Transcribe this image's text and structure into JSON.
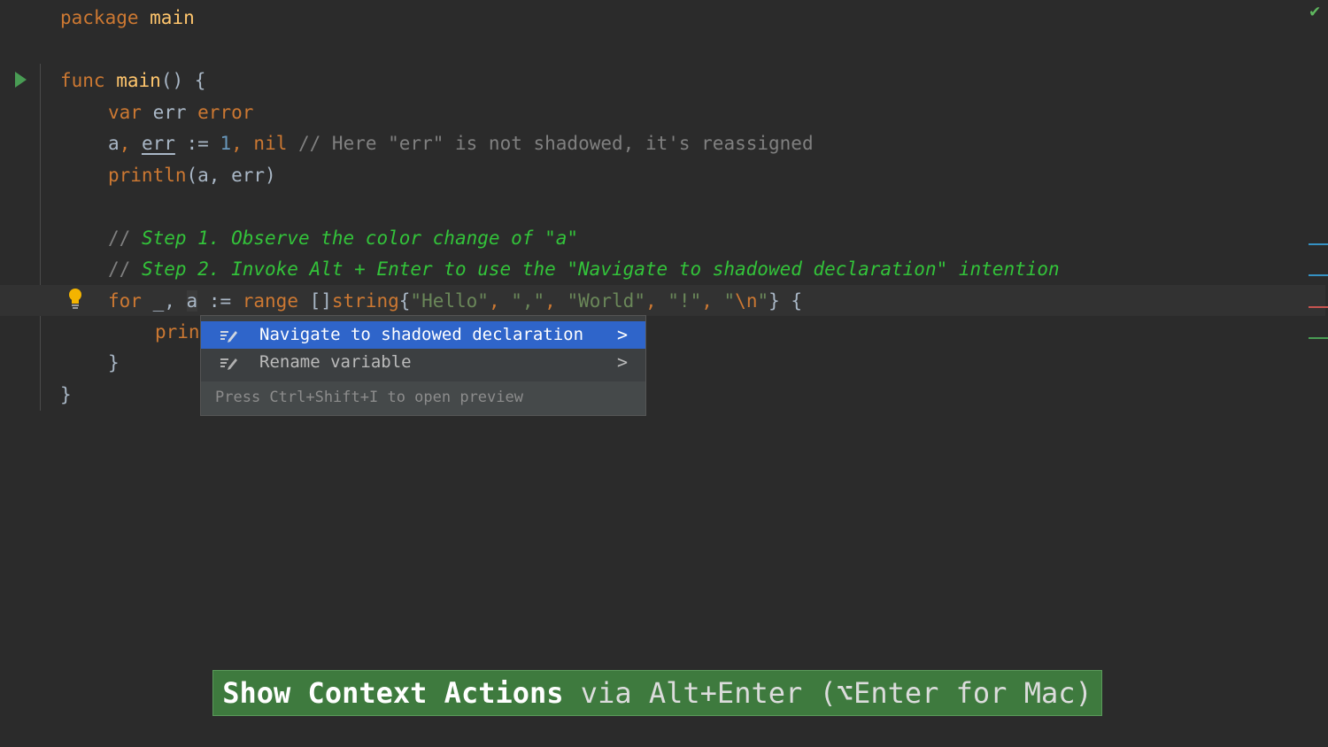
{
  "editor": {
    "line1": [
      "package",
      " main"
    ],
    "line2": [
      "func",
      " ",
      "main",
      "() {"
    ],
    "line3": [
      "var",
      " err ",
      "error"
    ],
    "line4": [
      "a",
      ", ",
      "err",
      " := ",
      "1",
      ", ",
      "nil",
      " // Here \"err\" is not shadowed, it's reassigned"
    ],
    "line5": [
      "println",
      "(a, err)"
    ],
    "comment1": [
      "// ",
      "Step 1. Observe the color change of \"a\""
    ],
    "comment2": [
      "// ",
      "Step 2. Invoke Alt + Enter to use the \"Navigate to shadowed declaration\" intention"
    ],
    "line8": [
      "for",
      " _, ",
      "a",
      " := ",
      "range",
      " []",
      "string",
      "{",
      "\"Hello\"",
      ", ",
      "\",\"",
      ", ",
      "\"World\"",
      ", ",
      "\"!\"",
      ", ",
      "\"",
      "\\n",
      "\"",
      "} {"
    ],
    "line9": "prin",
    "line10": "}",
    "line11": "}"
  },
  "popup": {
    "items": [
      {
        "label": "Navigate to shadowed declaration",
        "arrow": ">"
      },
      {
        "label": "Rename variable",
        "arrow": ">"
      }
    ],
    "footer": "Press Ctrl+Shift+I to open preview"
  },
  "banner": {
    "bold": "Show Context Actions",
    "rest": " via Alt+Enter (⌥Enter for Mac)"
  },
  "colors": {
    "keyword": "#cc7832",
    "function": "#ffc66d",
    "number": "#6897bb",
    "string": "#6a8759",
    "comment": "#808080",
    "todo_comment": "#33c33a",
    "selection": "#2f65ca",
    "banner_bg": "#3e7a3e"
  },
  "icons": [
    "run-icon",
    "check-icon",
    "intention-bulb-icon",
    "intention-pencil-icon",
    "chevron-right-icon"
  ]
}
